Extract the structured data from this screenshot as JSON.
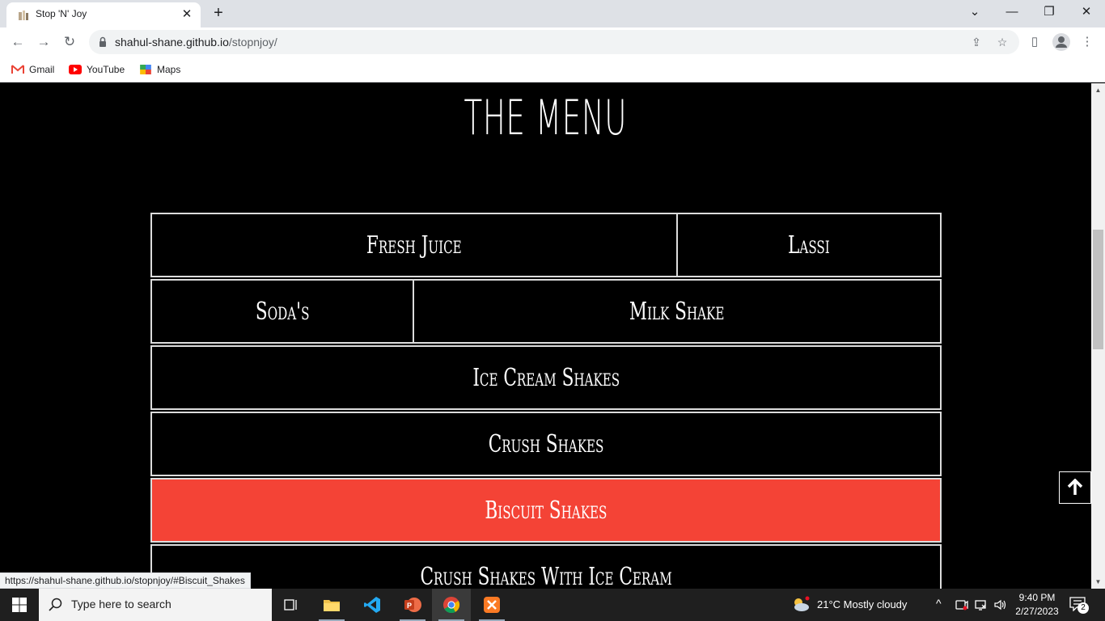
{
  "browser": {
    "tab_title": "Stop 'N' Joy",
    "url_host": "shahul-shane.github.io",
    "url_path": "/stopnjoy/",
    "bookmarks": [
      {
        "label": "Gmail",
        "icon": "gmail-icon"
      },
      {
        "label": "YouTube",
        "icon": "youtube-icon"
      },
      {
        "label": "Maps",
        "icon": "maps-icon"
      }
    ],
    "status_url": "https://shahul-shane.github.io/stopnjoy/#Biscuit_Shakes"
  },
  "page": {
    "title": "THE MENU",
    "menu": [
      {
        "label": "Fresh Juice"
      },
      {
        "label": "Lassi"
      },
      {
        "label": "Soda's"
      },
      {
        "label": "Milk Shake"
      },
      {
        "label": "Ice Cream Shakes"
      },
      {
        "label": "Crush Shakes"
      },
      {
        "label": "Biscuit Shakes",
        "active": true
      },
      {
        "label": "Crush Shakes With Ice Ceram"
      }
    ],
    "active_color": "#f44336"
  },
  "taskbar": {
    "search_placeholder": "Type here to search",
    "weather": "21°C  Mostly cloudy",
    "time": "9:40 PM",
    "date": "2/27/2023",
    "notification_count": "2"
  }
}
